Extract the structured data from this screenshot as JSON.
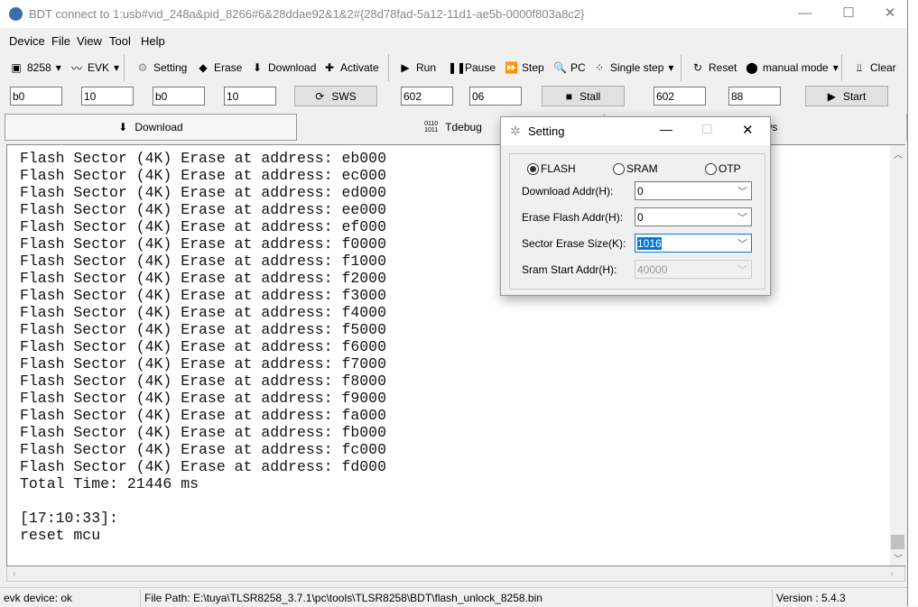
{
  "window": {
    "title": "BDT connect to 1:usb#vid_248a&pid_8266#6&28ddae92&1&2#{28d78fad-5a12-11d1-ae5b-0000f803a8c2}"
  },
  "menu": [
    "Device",
    "File",
    "View",
    "Tool",
    "Help"
  ],
  "toolbar": {
    "chip": "8258",
    "board": "EVK",
    "setting": "Setting",
    "erase": "Erase",
    "download": "Download",
    "activate": "Activate",
    "run": "Run",
    "pause": "Pause",
    "step": "Step",
    "pc": "PC",
    "single_step": "Single step",
    "reset": "Reset",
    "mode": "manual mode",
    "clear": "Clear"
  },
  "fields": {
    "f1": "b0",
    "f2": "10",
    "f3": "b0",
    "f4": "10",
    "sws": "SWS",
    "f5": "602",
    "f6": "06",
    "stall": "Stall",
    "f7": "602",
    "f8": "88",
    "start": "Start"
  },
  "tabs": [
    "Download",
    "Tdebug",
    "Windows"
  ],
  "log": [
    "Flash Sector (4K) Erase at address: eb000",
    "Flash Sector (4K) Erase at address: ec000",
    "Flash Sector (4K) Erase at address: ed000",
    "Flash Sector (4K) Erase at address: ee000",
    "Flash Sector (4K) Erase at address: ef000",
    "Flash Sector (4K) Erase at address: f0000",
    "Flash Sector (4K) Erase at address: f1000",
    "Flash Sector (4K) Erase at address: f2000",
    "Flash Sector (4K) Erase at address: f3000",
    "Flash Sector (4K) Erase at address: f4000",
    "Flash Sector (4K) Erase at address: f5000",
    "Flash Sector (4K) Erase at address: f6000",
    "Flash Sector (4K) Erase at address: f7000",
    "Flash Sector (4K) Erase at address: f8000",
    "Flash Sector (4K) Erase at address: f9000",
    "Flash Sector (4K) Erase at address: fa000",
    "Flash Sector (4K) Erase at address: fb000",
    "Flash Sector (4K) Erase at address: fc000",
    "Flash Sector (4K) Erase at address: fd000",
    "Total Time: 21446 ms",
    "",
    "[17:10:33]:",
    "reset mcu"
  ],
  "status": {
    "device": "evk device: ok",
    "path": "File Path:  E:\\tuya\\TLSR8258_3.7.1\\pc\\tools\\TLSR8258\\BDT\\flash_unlock_8258.bin",
    "version": "Version : 5.4.3"
  },
  "dialog": {
    "title": "Setting",
    "radios": [
      {
        "label": "FLASH",
        "checked": true
      },
      {
        "label": "SRAM",
        "checked": false
      },
      {
        "label": "OTP",
        "checked": false
      }
    ],
    "rows": [
      {
        "label": "Download  Addr(H):",
        "value": "0"
      },
      {
        "label": "Erase Flash Addr(H):",
        "value": "0"
      },
      {
        "label": "Sector Erase Size(K):",
        "value": "1016"
      },
      {
        "label": "Sram Start Addr(H):",
        "value": "40000"
      }
    ]
  }
}
